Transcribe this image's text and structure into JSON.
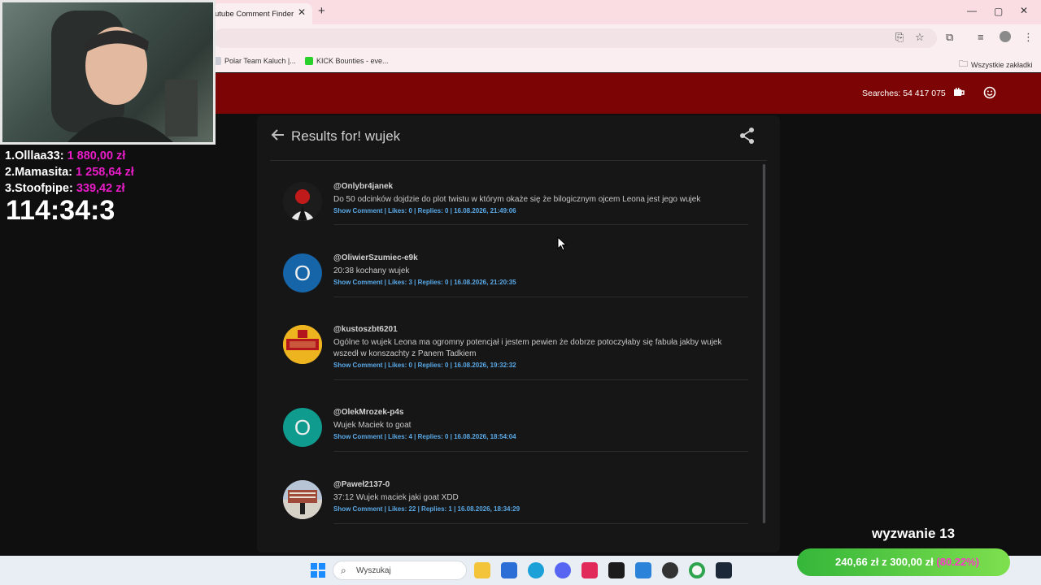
{
  "browser": {
    "tab_title": "utube Comment Finder",
    "new_tab": "+",
    "bookmarks": [
      {
        "label": "Polar Team Kaluch |..."
      },
      {
        "label": "KICK Bounties - eve..."
      }
    ],
    "all_bookmarks": "Wszystkie zakładki"
  },
  "site": {
    "searches_label": "Searches: 54 417 075",
    "results_title": "Results for! wujek"
  },
  "comments": [
    {
      "user": "@Onlybr4janek",
      "text": "Do 50 odcinków dojdzie do plot twistu w którym okaże się że bilogicznym ojcem Leona jest jego wujek",
      "meta": "Show Comment | Likes: 0 | Replies: 0 | 16.08.2026, 21:49:06",
      "avatar_letter": "",
      "avatar_color": "#3a3a3a"
    },
    {
      "user": "@OliwierSzumiec-e9k",
      "text": "20:38 kochany wujek",
      "meta": "Show Comment | Likes: 3 | Replies: 0 | 16.08.2026, 21:20:35",
      "avatar_letter": "O",
      "avatar_color": "#1565a8"
    },
    {
      "user": "@kustoszbt6201",
      "text": "Ogólne to wujek Leona ma ogromny potencjał i jestem pewien że dobrze potoczyłaby się fabuła jakby wujek wszedł w konszachty z Panem Tadkiem",
      "meta": "Show Comment | Likes: 0 | Replies: 0 | 16.08.2026, 19:32:32",
      "avatar_letter": "",
      "avatar_color": "#e7b320"
    },
    {
      "user": "@OlekMrozek-p4s",
      "text": "Wujek Maciek to goat",
      "meta": "Show Comment | Likes: 4 | Replies: 0 | 16.08.2026, 18:54:04",
      "avatar_letter": "O",
      "avatar_color": "#0f9b8e"
    },
    {
      "user": "@Paweł2137-0",
      "text": "37:12 Wujek maciek jaki goat XDD",
      "meta": "Show Comment | Likes: 22 | Replies: 1 | 16.08.2026, 18:34:29",
      "avatar_letter": "",
      "avatar_color": "#8a94a6"
    }
  ],
  "overlay": {
    "leaderboard": [
      {
        "rank_name": "1.Olllaa33:",
        "amount": "1 880,00 zł"
      },
      {
        "rank_name": "2.Mamasita:",
        "amount": "1 258,64 zł"
      },
      {
        "rank_name": "3.Stoofpipe:",
        "amount": "339,42 zł"
      }
    ],
    "timer": "114:34:3",
    "challenge": "wyzwanie 13",
    "goal_amount": "240,66 zł",
    "goal_of": "z",
    "goal_target": "300,00 zł",
    "goal_percent": "(80.22%)",
    "goal_fraction": 0.8022
  },
  "taskbar": {
    "search_placeholder": "Wyszukaj"
  },
  "colors": {
    "header": "#7d0404",
    "link": "#5aa9e6",
    "donation_pink": "#e81cc6"
  }
}
